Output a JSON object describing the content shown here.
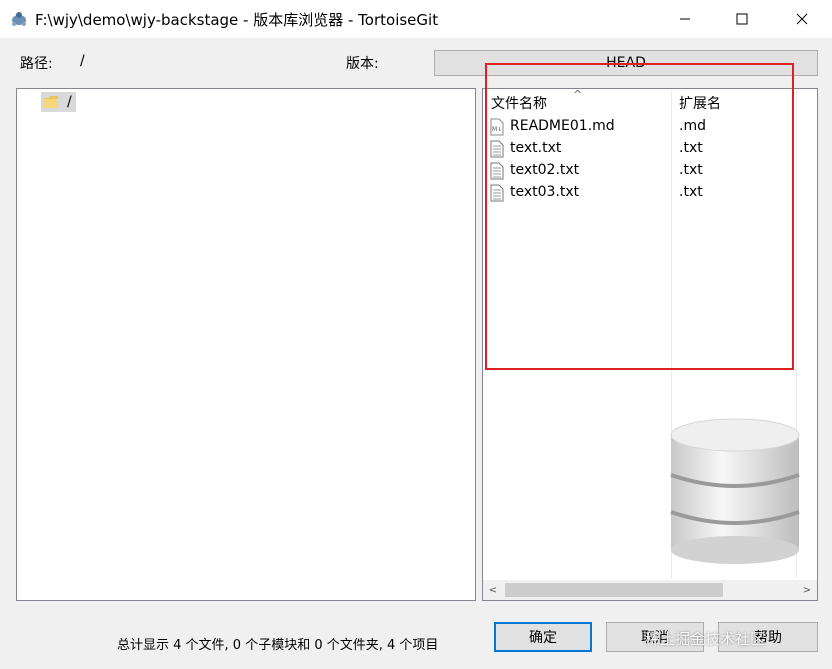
{
  "window": {
    "title": "F:\\wjy\\demo\\wjy-backstage - 版本库浏览器 - TortoiseGit"
  },
  "path_row": {
    "path_label": "路径:",
    "path_value": "/",
    "revision_label": "版本:",
    "revision_value": "HEAD"
  },
  "tree": {
    "items": [
      {
        "label": "/",
        "icon": "folder-icon"
      }
    ]
  },
  "file_list": {
    "columns": [
      "文件名称",
      "扩展名"
    ],
    "sort_indicator": "^",
    "rows": [
      {
        "name": "README01.md",
        "ext": ".md",
        "icon": "markdown-file-icon"
      },
      {
        "name": "text.txt",
        "ext": ".txt",
        "icon": "text-file-icon"
      },
      {
        "name": "text02.txt",
        "ext": ".txt",
        "icon": "text-file-icon"
      },
      {
        "name": "text03.txt",
        "ext": ".txt",
        "icon": "text-file-icon"
      }
    ]
  },
  "footer": {
    "status": "总计显示 4 个文件, 0 个子模块和 0 个文件夹, 4 个项目",
    "ok_label": "确定",
    "cancel_label": "取消",
    "help_label": "帮助"
  },
  "watermark": "稀土掘金技术社区",
  "colors": {
    "highlight": "#e02020",
    "focus": "#0078d7"
  }
}
